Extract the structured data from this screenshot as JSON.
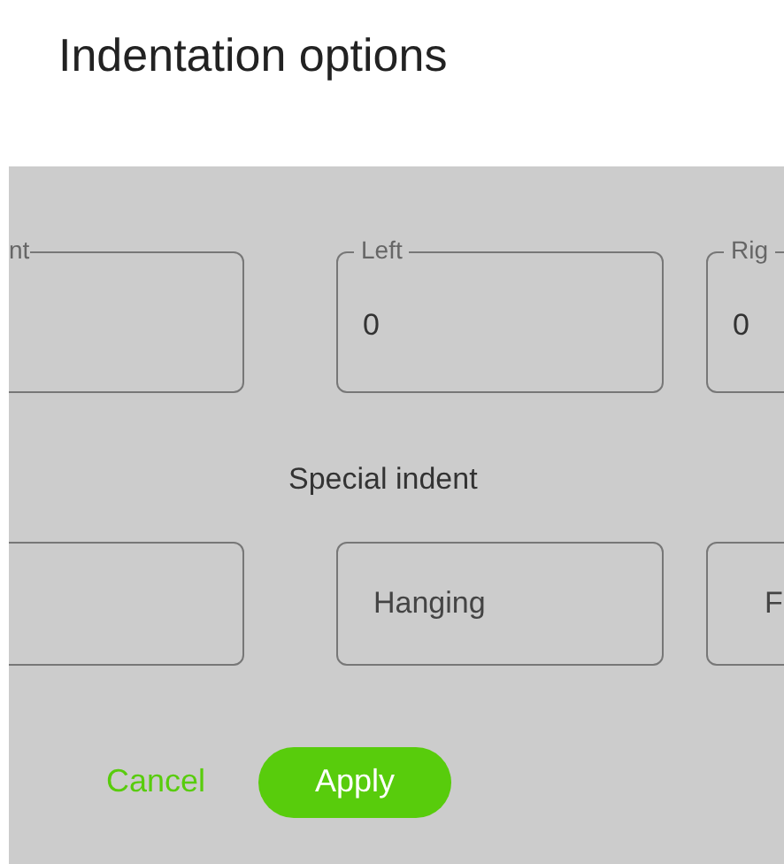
{
  "title": "Indentation options",
  "fields": [
    {
      "label": "nt"
    },
    {
      "label": "Left",
      "value": "0"
    },
    {
      "label": "Rig",
      "value": "0"
    }
  ],
  "special_indent": {
    "label": "Special indent",
    "options": [
      {
        "selected": false
      },
      {
        "label": "Hanging",
        "selected": false
      },
      {
        "label": "F",
        "selected": false
      }
    ]
  },
  "buttons": [
    {
      "kind": "text",
      "label": "Cancel"
    },
    {
      "kind": "primary",
      "label": "Apply"
    }
  ]
}
